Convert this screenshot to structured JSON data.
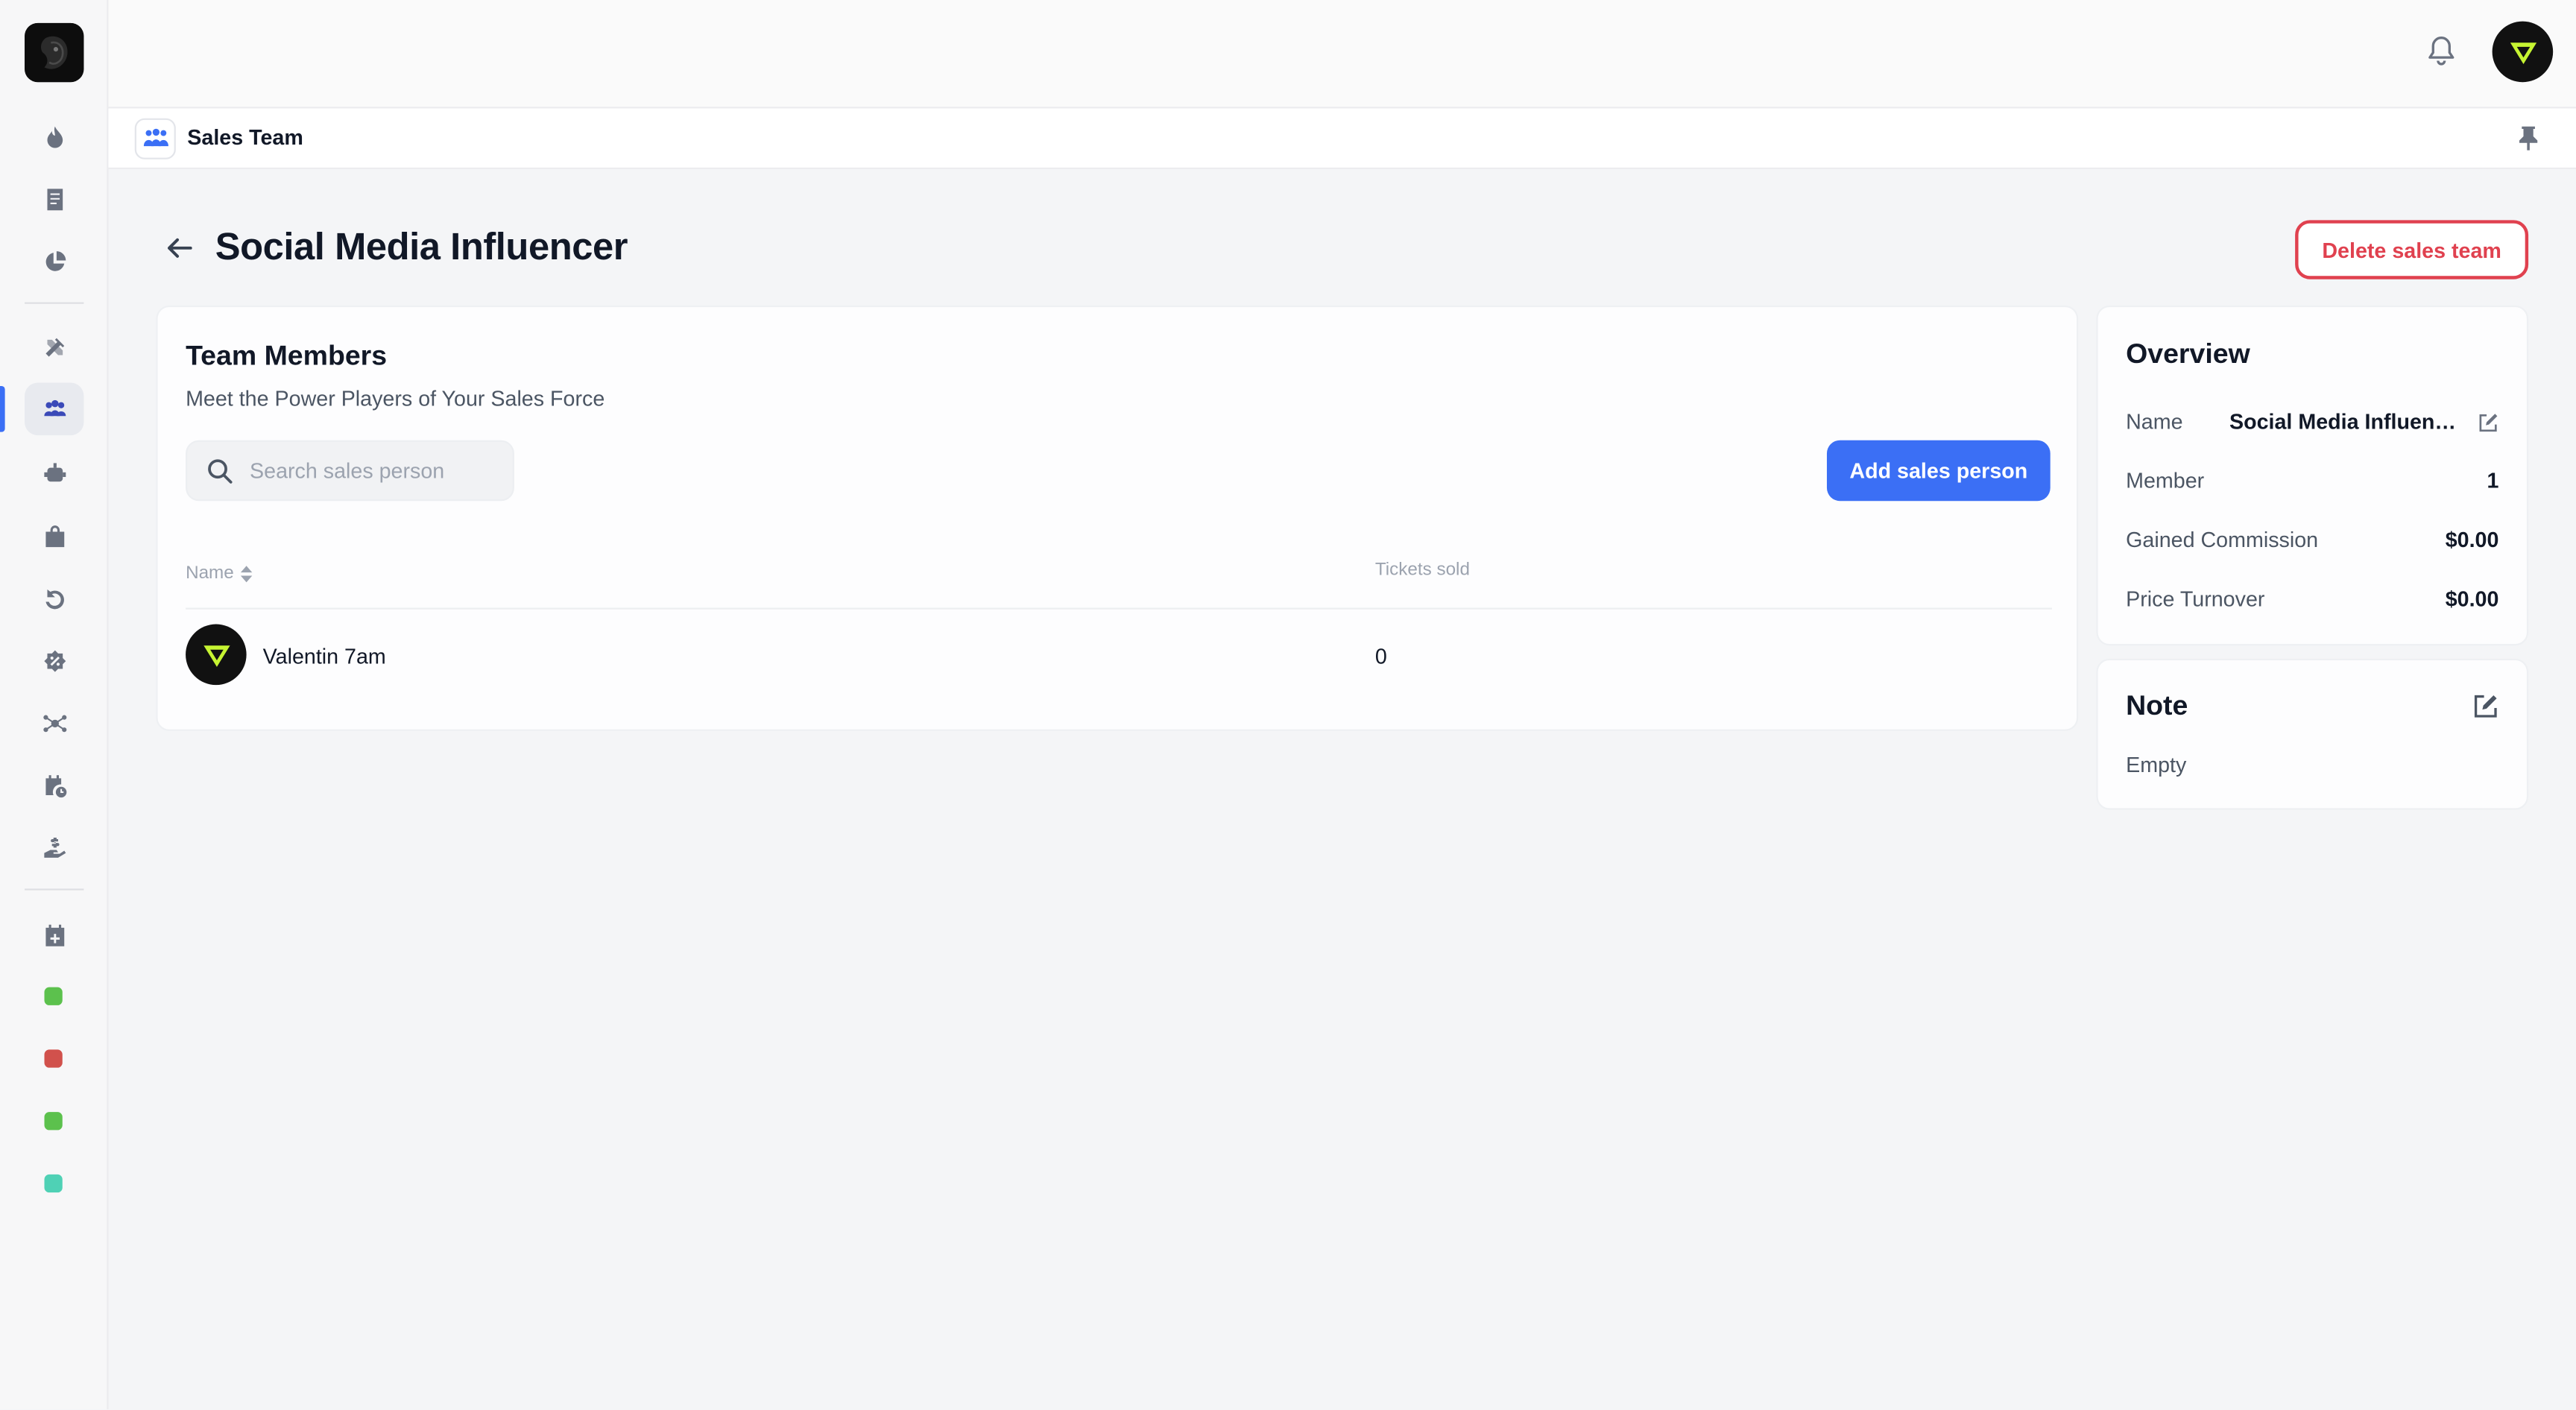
{
  "app": {
    "section_title": "Sales Team",
    "page_title": "Social Media Influencer"
  },
  "sidebar": {
    "items": [
      {
        "icon": "fire-icon"
      },
      {
        "icon": "document-icon"
      },
      {
        "icon": "pie-chart-icon"
      },
      {
        "icon": "tools-icon"
      },
      {
        "icon": "team-icon",
        "active": true
      },
      {
        "icon": "robot-icon"
      },
      {
        "icon": "bag-icon"
      },
      {
        "icon": "undo-icon"
      },
      {
        "icon": "discount-icon"
      },
      {
        "icon": "network-icon"
      },
      {
        "icon": "calendar-clock-icon"
      },
      {
        "icon": "hand-money-icon"
      },
      {
        "icon": "calendar-add-icon"
      }
    ],
    "event_colors": [
      "#5cc14d",
      "#d1514c",
      "#5cc14d",
      "#4fd1b5"
    ]
  },
  "header": {
    "delete_label": "Delete sales team"
  },
  "members": {
    "title": "Team Members",
    "subtitle": "Meet the Power Players of Your Sales Force",
    "search_placeholder": "Search sales person",
    "search_value": "",
    "add_label": "Add sales person",
    "columns": {
      "name": "Name",
      "tickets": "Tickets sold"
    },
    "rows": [
      {
        "name": "Valentin 7am",
        "tickets": "0"
      }
    ]
  },
  "overview": {
    "title": "Overview",
    "name_label": "Name",
    "name_value": "Social Media Influencer",
    "member_label": "Member",
    "member_value": "1",
    "commission_label": "Gained Commission",
    "commission_value": "$0.00",
    "turnover_label": "Price Turnover",
    "turnover_value": "$0.00"
  },
  "note": {
    "title": "Note",
    "text": "Empty"
  },
  "colors": {
    "accent": "#3b6ff5",
    "danger": "#e0414f",
    "brand_green": "#c6f432"
  }
}
